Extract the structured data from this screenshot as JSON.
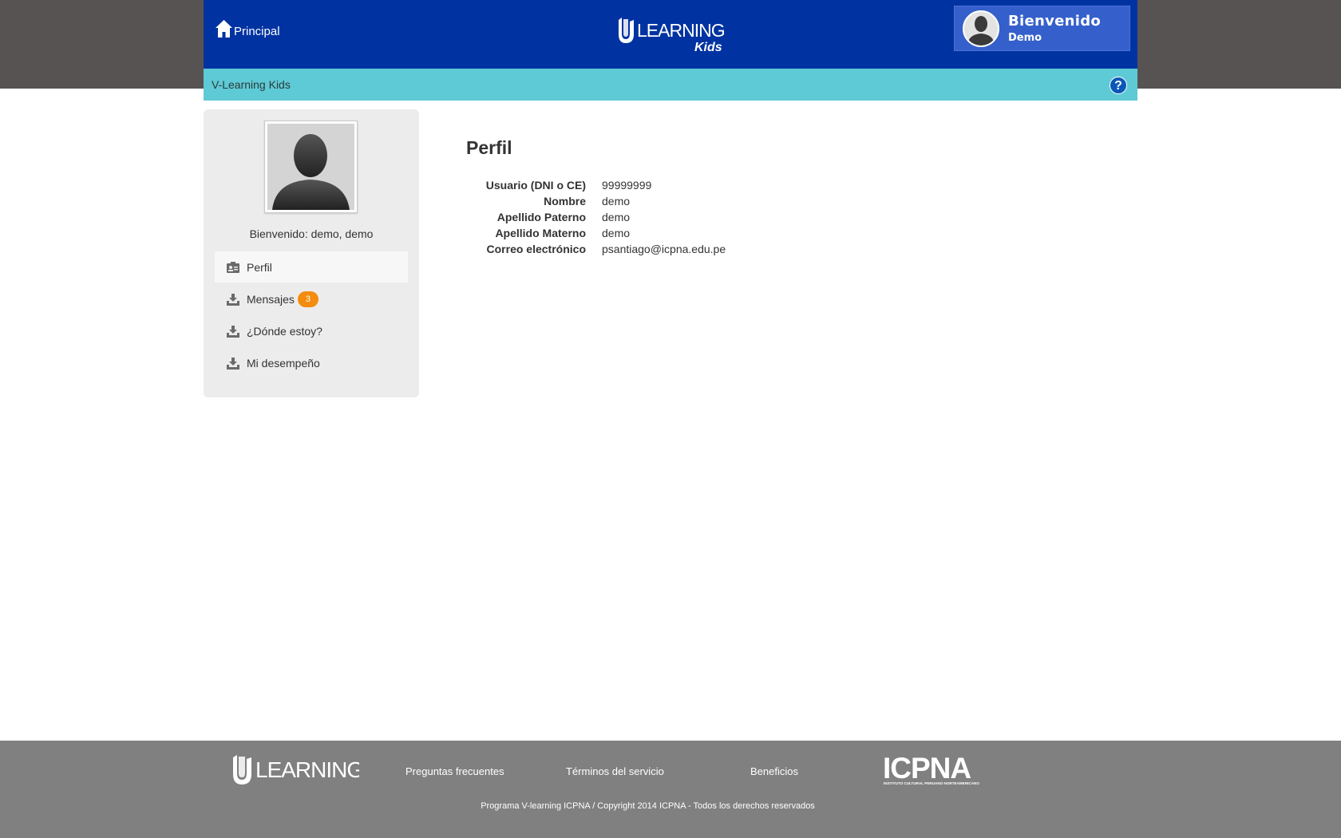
{
  "header": {
    "home_label": "Principal",
    "logo_text": "LEARNING",
    "logo_sub": "Kids",
    "welcome_title": "Bienvenido",
    "welcome_name": "Demo",
    "bg_color": "#0033a1"
  },
  "subbar": {
    "title": "V-Learning Kids",
    "help_label": "?"
  },
  "sidebar": {
    "greeting": "Bienvenido: demo, demo",
    "items": [
      {
        "label": "Perfil",
        "icon": "profile-card-icon",
        "active": true
      },
      {
        "label": "Mensajes",
        "icon": "download-tray-icon",
        "badge": "3"
      },
      {
        "label": "¿Dónde estoy?",
        "icon": "download-tray-icon"
      },
      {
        "label": "Mi desempeño",
        "icon": "download-tray-icon"
      }
    ]
  },
  "profile": {
    "title": "Perfil",
    "fields": [
      {
        "label": "Usuario (DNI o CE)",
        "value": "99999999"
      },
      {
        "label": "Nombre",
        "value": "demo"
      },
      {
        "label": "Apellido Paterno",
        "value": "demo"
      },
      {
        "label": "Apellido Materno",
        "value": "demo"
      },
      {
        "label": "Correo electrónico",
        "value": "psantiago@icpna.edu.pe"
      }
    ]
  },
  "footer": {
    "logo_text": "LEARNING",
    "links": [
      "Preguntas frecuentes",
      "Términos del servicio",
      "Beneficios"
    ],
    "icpna_text": "ICPNA",
    "icpna_sub": "INSTITUTO CULTURAL PERUANO NORTEAMERICANO",
    "copyright": "Programa V-learning ICPNA / Copyright 2014 ICPNA - Todos los derechos reservados"
  },
  "colors": {
    "accent_cyan": "#5ecad5",
    "badge_orange": "#f38c0f",
    "footer_gray": "#808080"
  }
}
